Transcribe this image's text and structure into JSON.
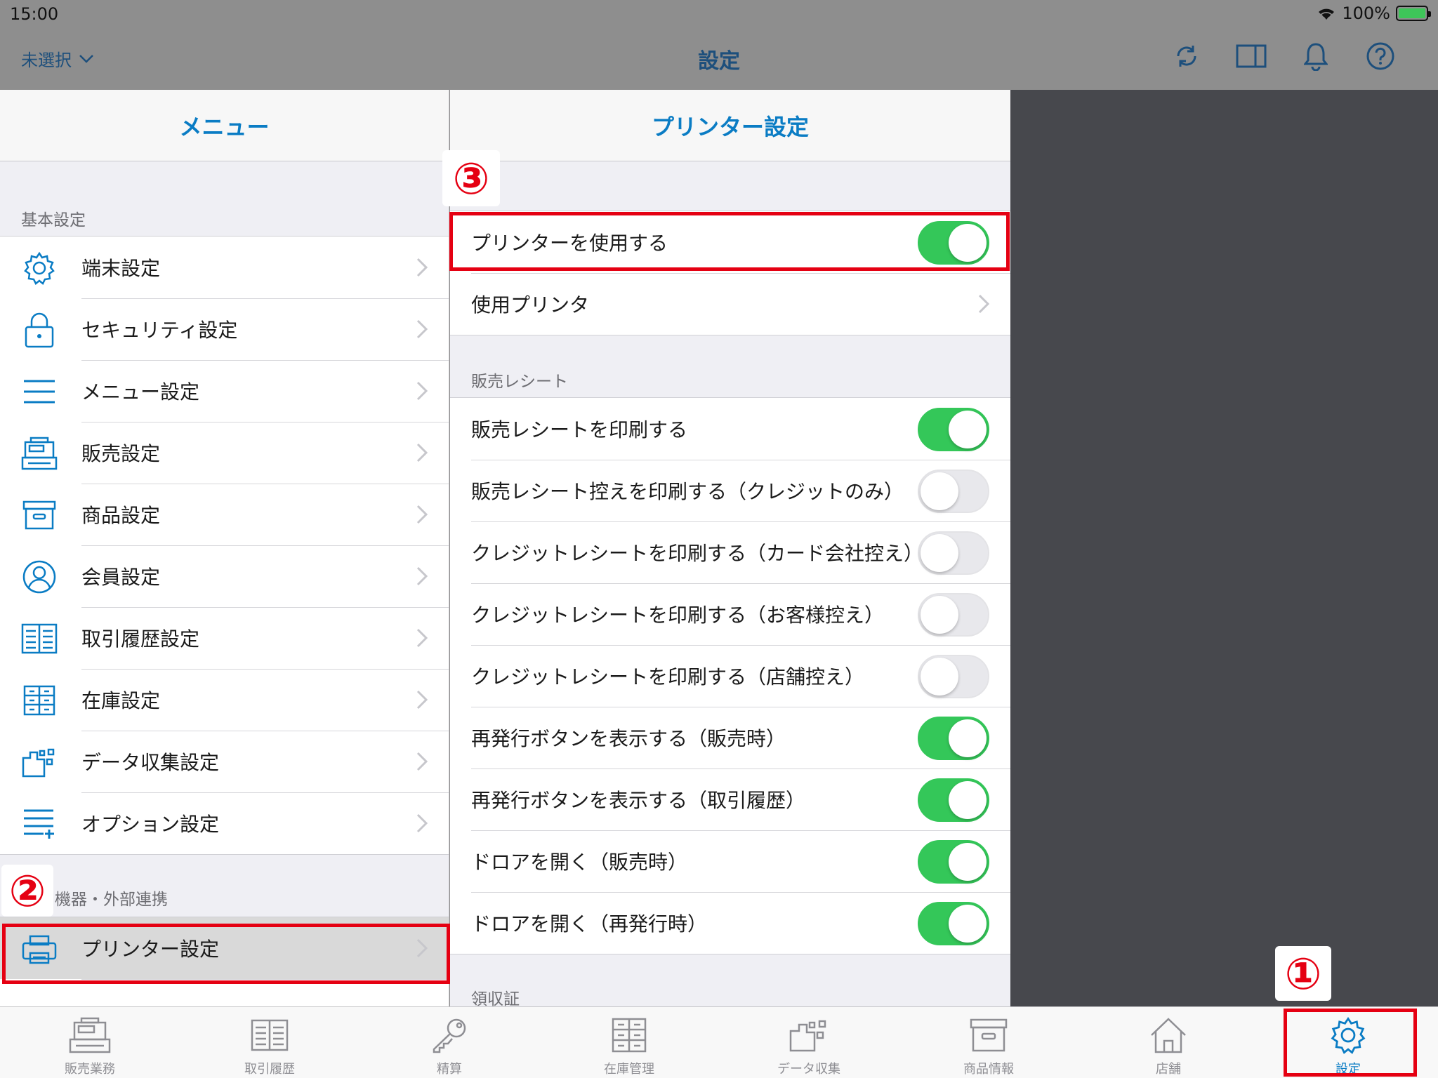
{
  "status": {
    "time": "15:00",
    "battery": "100%"
  },
  "nav": {
    "selector": "未選択",
    "title": "設定"
  },
  "menu": {
    "header": "メニュー",
    "section_basic": "基本設定",
    "basic_items": [
      {
        "label": "端末設定",
        "icon": "gear-icon"
      },
      {
        "label": "セキュリティ設定",
        "icon": "lock-icon"
      },
      {
        "label": "メニュー設定",
        "icon": "list-icon"
      },
      {
        "label": "販売設定",
        "icon": "register-icon"
      },
      {
        "label": "商品設定",
        "icon": "box-icon"
      },
      {
        "label": "会員設定",
        "icon": "person-icon"
      },
      {
        "label": "取引履歴設定",
        "icon": "book-icon"
      },
      {
        "label": "在庫設定",
        "icon": "cabinet-icon"
      },
      {
        "label": "データ収集設定",
        "icon": "data-icon"
      },
      {
        "label": "オプション設定",
        "icon": "list-plus-icon"
      }
    ],
    "section_device": "機器・外部連携",
    "device_items": [
      {
        "label": "プリンター設定",
        "icon": "printer-icon",
        "selected": true
      }
    ]
  },
  "printer": {
    "header": "プリンター設定",
    "use_printer": {
      "label": "プリンターを使用する",
      "on": true
    },
    "printer_select": {
      "label": "使用プリンタ"
    },
    "section_receipt": "販売レシート",
    "receipt_items": [
      {
        "label": "販売レシートを印刷する",
        "on": true
      },
      {
        "label": "販売レシート控えを印刷する（クレジットのみ）",
        "on": false
      },
      {
        "label": "クレジットレシートを印刷する（カード会社控え）",
        "on": false
      },
      {
        "label": "クレジットレシートを印刷する（お客様控え）",
        "on": false
      },
      {
        "label": "クレジットレシートを印刷する（店舗控え）",
        "on": false
      },
      {
        "label": "再発行ボタンを表示する（販売時）",
        "on": true
      },
      {
        "label": "再発行ボタンを表示する（取引履歴）",
        "on": true
      },
      {
        "label": "ドロアを開く（販売時）",
        "on": true
      },
      {
        "label": "ドロアを開く（再発行時）",
        "on": true
      }
    ],
    "section_invoice": "領収証"
  },
  "tabs": [
    {
      "label": "販売業務",
      "icon": "register-icon"
    },
    {
      "label": "取引履歴",
      "icon": "book-icon"
    },
    {
      "label": "精算",
      "icon": "key-icon"
    },
    {
      "label": "在庫管理",
      "icon": "cabinet-icon"
    },
    {
      "label": "データ収集",
      "icon": "data-icon"
    },
    {
      "label": "商品情報",
      "icon": "box-icon"
    },
    {
      "label": "店舗",
      "icon": "house-icon"
    },
    {
      "label": "設定",
      "icon": "gear-icon",
      "active": true
    }
  ],
  "markers": {
    "m1": "①",
    "m2": "②",
    "m3": "③"
  },
  "colors": {
    "accent": "#0a7cc4",
    "toggle_on": "#34c759",
    "highlight": "#e50012"
  }
}
